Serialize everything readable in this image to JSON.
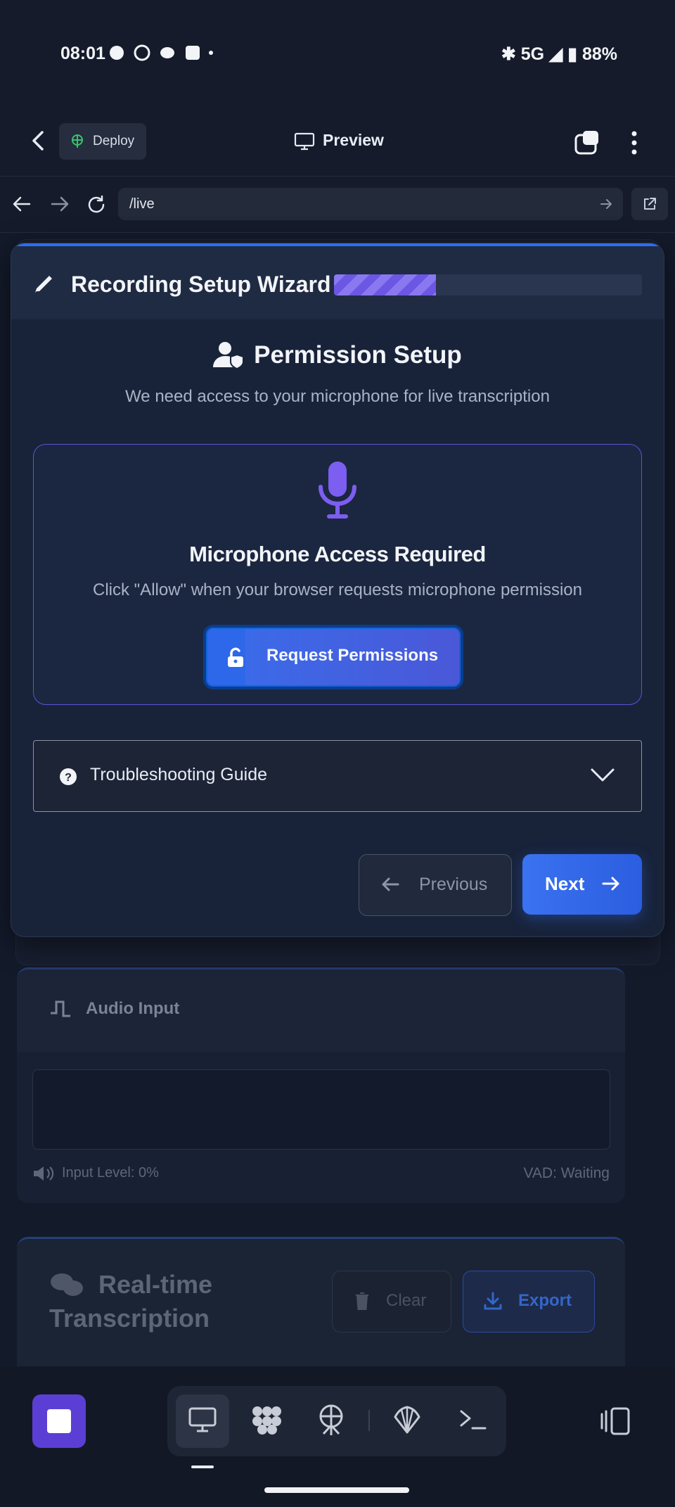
{
  "status_bar": {
    "time": "08:01",
    "network": "5G",
    "battery": "88%"
  },
  "app_bar": {
    "deploy_label": "Deploy",
    "preview_label": "Preview"
  },
  "browser": {
    "url": "/live"
  },
  "wizard": {
    "title": "Recording Setup Wizard",
    "progress": 0.33,
    "step_title": "Permission Setup",
    "step_subtitle": "We need access to your microphone for live transcription",
    "mic_title": "Microphone Access Required",
    "mic_subtitle": "Click \"Allow\" when your browser requests microphone permission",
    "request_button": "Request Permissions",
    "troubleshooting": "Troubleshooting Guide",
    "previous_button": "Previous",
    "next_button": "Next"
  },
  "audio_input": {
    "title": "Audio Input",
    "input_level": "Input Level: 0%",
    "vad": "VAD: Waiting"
  },
  "transcription": {
    "title": "Real-time Transcription",
    "clear_button": "Clear",
    "export_button": "Export"
  },
  "colors": {
    "accent": "#2e6cf0",
    "purple": "#6b57e3",
    "background": "#131a2a"
  }
}
